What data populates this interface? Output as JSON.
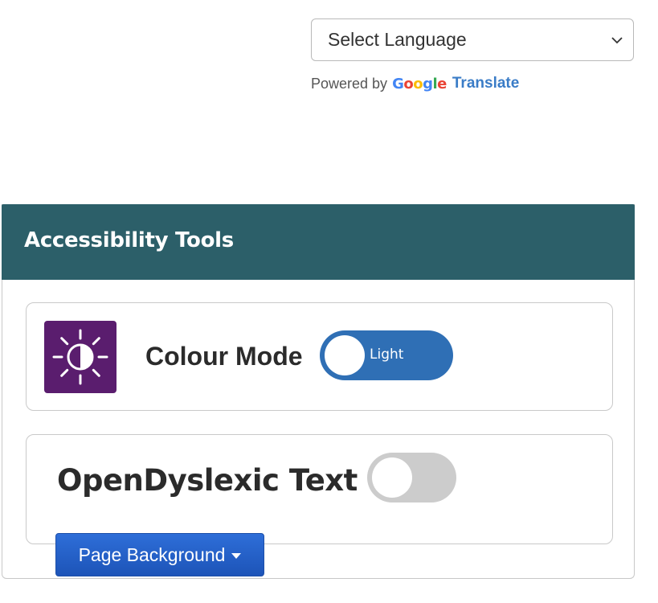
{
  "language_select": {
    "selected": "Select Language",
    "icon": "chevron-down-icon"
  },
  "powered_by": {
    "prefix": "Powered by",
    "google_letters": [
      "G",
      "o",
      "o",
      "g",
      "l",
      "e"
    ],
    "google_colors": [
      "#4285F4",
      "#EA4335",
      "#FBBC05",
      "#4285F4",
      "#34A853",
      "#EA4335"
    ],
    "translate": "Translate"
  },
  "accessibility": {
    "title": "Accessibility Tools",
    "header_color": "#2c5f69",
    "colour_mode": {
      "icon": "contrast-sun-icon",
      "label": "Colour Mode",
      "state": "Light",
      "on": true
    },
    "dyslexic": {
      "label": "OpenDyslexic Text",
      "on": false
    },
    "page_background": {
      "label": "Page Background",
      "icon": "caret-down-icon"
    }
  }
}
